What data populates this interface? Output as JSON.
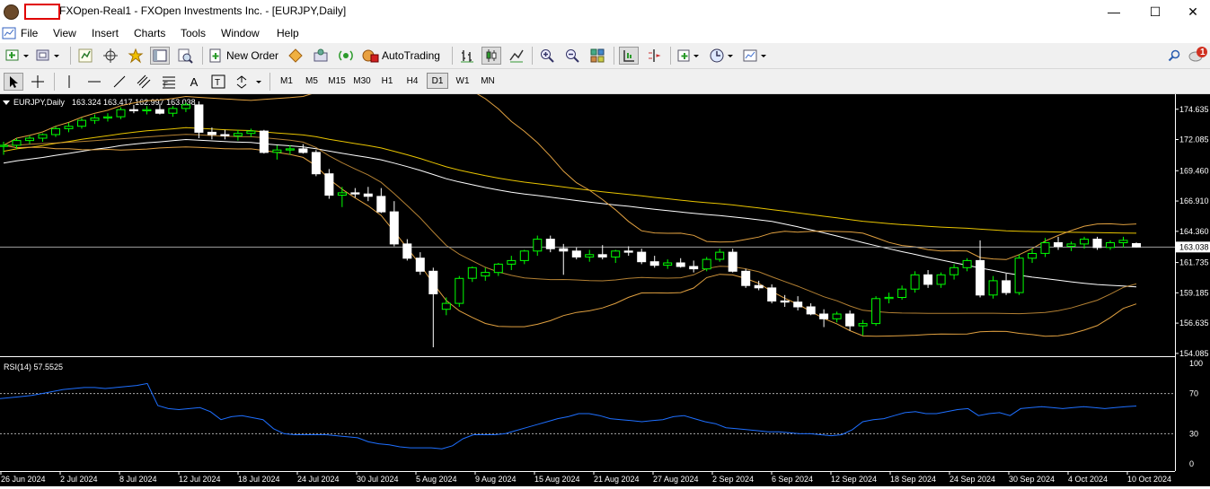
{
  "window": {
    "title": "FXOpen-Real1 - FXOpen Investments Inc. - [EURJPY,Daily]",
    "minimize": "—",
    "maximize": "☐",
    "close": "✕"
  },
  "menu": [
    "File",
    "View",
    "Insert",
    "Charts",
    "Tools",
    "Window",
    "Help"
  ],
  "mdi_controls": [
    "_",
    "🗗",
    "✕"
  ],
  "toolbar": {
    "new_order": "New Order",
    "auto_trading": "AutoTrading",
    "alert_count": "1"
  },
  "timeframes": [
    "M1",
    "M5",
    "M15",
    "M30",
    "H1",
    "H4",
    "D1",
    "W1",
    "MN"
  ],
  "active_timeframe": "D1",
  "colors": {
    "bg": "#000000",
    "bull_candle": "#00ff00",
    "bear_candle": "#ffffff",
    "ma_white": "#ffffff",
    "ma_yellow": "#e8c400",
    "band_orange": "#e0a040",
    "price_line": "#a0a0a0",
    "rsi_line": "#1e6fff",
    "axis_text": "#ffffff"
  },
  "chart_data": [
    {
      "type": "candlestick",
      "title": "EURJPY,Daily",
      "ohlc_label": "163.324 163.417 162.997 163.038",
      "current_price": 163.038,
      "ylim": [
        154.085,
        175.9
      ],
      "y_ticks": [
        "174.635",
        "172.085",
        "169.460",
        "166.910",
        "164.360",
        "163.038",
        "161.735",
        "159.185",
        "156.635",
        "154.085"
      ],
      "x_ticks": [
        "26 Jun 2024",
        "2 Jul 2024",
        "8 Jul 2024",
        "12 Jul 2024",
        "18 Jul 2024",
        "24 Jul 2024",
        "30 Jul 2024",
        "5 Aug 2024",
        "9 Aug 2024",
        "15 Aug 2024",
        "21 Aug 2024",
        "27 Aug 2024",
        "2 Sep 2024",
        "6 Sep 2024",
        "12 Sep 2024",
        "18 Sep 2024",
        "24 Sep 2024",
        "30 Sep 2024",
        "4 Oct 2024",
        "10 Oct 2024"
      ],
      "candles": [
        [
          171.5,
          171.9,
          170.8,
          171.6
        ],
        [
          171.6,
          172.2,
          171.3,
          172.0
        ],
        [
          172.0,
          172.4,
          171.7,
          172.2
        ],
        [
          172.2,
          172.6,
          171.9,
          172.5
        ],
        [
          172.5,
          173.2,
          172.3,
          173.0
        ],
        [
          173.0,
          173.5,
          172.7,
          173.2
        ],
        [
          173.2,
          173.9,
          173.0,
          173.7
        ],
        [
          173.7,
          174.2,
          173.4,
          173.9
        ],
        [
          173.9,
          174.3,
          173.6,
          174.0
        ],
        [
          174.0,
          174.8,
          173.8,
          174.6
        ],
        [
          174.6,
          175.0,
          174.3,
          174.5
        ],
        [
          174.5,
          174.9,
          174.2,
          174.6
        ],
        [
          174.6,
          175.1,
          174.2,
          174.3
        ],
        [
          174.3,
          174.9,
          174.0,
          174.7
        ],
        [
          174.7,
          175.2,
          174.4,
          175.0
        ],
        [
          175.0,
          175.3,
          172.2,
          172.7
        ],
        [
          172.7,
          173.1,
          172.1,
          172.5
        ],
        [
          172.5,
          172.9,
          172.1,
          172.4
        ],
        [
          172.4,
          172.9,
          172.0,
          172.6
        ],
        [
          172.6,
          173.0,
          172.3,
          172.8
        ],
        [
          172.8,
          172.9,
          170.9,
          171.0
        ],
        [
          171.0,
          171.6,
          170.4,
          171.2
        ],
        [
          171.2,
          171.6,
          170.8,
          171.3
        ],
        [
          171.3,
          171.7,
          170.9,
          171.0
        ],
        [
          171.0,
          171.2,
          169.0,
          169.2
        ],
        [
          169.2,
          169.6,
          167.1,
          167.4
        ],
        [
          167.4,
          168.1,
          166.4,
          167.6
        ],
        [
          167.6,
          168.0,
          167.2,
          167.5
        ],
        [
          167.5,
          168.1,
          166.9,
          167.3
        ],
        [
          167.3,
          168.0,
          165.9,
          166.0
        ],
        [
          166.0,
          166.9,
          163.1,
          163.3
        ],
        [
          163.3,
          163.7,
          161.9,
          162.1
        ],
        [
          162.1,
          162.6,
          160.7,
          161.0
        ],
        [
          161.0,
          161.3,
          154.6,
          159.1
        ],
        [
          157.8,
          158.8,
          157.3,
          158.3
        ],
        [
          158.3,
          160.6,
          158.0,
          160.4
        ],
        [
          160.4,
          161.4,
          160.1,
          161.3
        ],
        [
          160.6,
          161.3,
          160.2,
          160.9
        ],
        [
          160.9,
          161.7,
          160.6,
          161.6
        ],
        [
          161.6,
          162.3,
          161.1,
          161.9
        ],
        [
          161.9,
          162.8,
          161.6,
          162.7
        ],
        [
          162.7,
          164.0,
          162.3,
          163.7
        ],
        [
          163.7,
          164.0,
          162.6,
          162.9
        ],
        [
          162.9,
          163.3,
          160.7,
          162.7
        ],
        [
          162.7,
          163.0,
          162.0,
          162.2
        ],
        [
          162.2,
          162.8,
          161.8,
          162.4
        ],
        [
          162.4,
          163.2,
          162.0,
          162.2
        ],
        [
          162.2,
          162.8,
          161.7,
          162.7
        ],
        [
          162.7,
          163.1,
          162.3,
          162.6
        ],
        [
          162.6,
          162.9,
          161.6,
          161.8
        ],
        [
          161.8,
          162.3,
          161.3,
          161.5
        ],
        [
          161.5,
          162.0,
          161.2,
          161.7
        ],
        [
          161.7,
          162.1,
          161.3,
          161.4
        ],
        [
          161.4,
          161.9,
          160.9,
          161.2
        ],
        [
          161.2,
          162.2,
          161.0,
          162.0
        ],
        [
          162.0,
          162.9,
          161.8,
          162.6
        ],
        [
          162.6,
          162.9,
          160.9,
          161.0
        ],
        [
          161.0,
          161.2,
          159.6,
          159.8
        ],
        [
          159.8,
          160.2,
          159.4,
          159.6
        ],
        [
          159.6,
          159.9,
          158.3,
          158.5
        ],
        [
          158.5,
          159.0,
          158.0,
          158.4
        ],
        [
          158.4,
          158.9,
          157.7,
          158.0
        ],
        [
          158.0,
          158.3,
          157.3,
          157.4
        ],
        [
          157.4,
          157.8,
          156.3,
          157.0
        ],
        [
          157.0,
          157.6,
          156.7,
          157.4
        ],
        [
          157.4,
          157.7,
          156.0,
          156.4
        ],
        [
          156.4,
          156.9,
          155.6,
          156.6
        ],
        [
          156.6,
          158.9,
          156.4,
          158.7
        ],
        [
          158.7,
          159.2,
          158.3,
          158.8
        ],
        [
          158.8,
          159.8,
          158.6,
          159.5
        ],
        [
          159.5,
          161.0,
          159.2,
          160.7
        ],
        [
          160.7,
          161.1,
          159.6,
          159.9
        ],
        [
          159.9,
          160.9,
          159.6,
          160.7
        ],
        [
          160.7,
          161.6,
          160.3,
          161.3
        ],
        [
          161.3,
          162.1,
          161.0,
          161.9
        ],
        [
          161.9,
          163.6,
          158.8,
          159.0
        ],
        [
          159.0,
          160.6,
          158.7,
          160.2
        ],
        [
          160.2,
          160.8,
          159.0,
          159.2
        ],
        [
          159.2,
          162.4,
          159.0,
          162.1
        ],
        [
          162.1,
          162.9,
          161.7,
          162.5
        ],
        [
          162.5,
          163.8,
          162.2,
          163.4
        ],
        [
          163.4,
          163.9,
          162.8,
          163.1
        ],
        [
          163.1,
          163.5,
          162.7,
          163.3
        ],
        [
          163.3,
          163.9,
          162.9,
          163.7
        ],
        [
          163.7,
          163.9,
          162.8,
          163.0
        ],
        [
          163.0,
          163.6,
          162.8,
          163.4
        ],
        [
          163.4,
          163.9,
          163.0,
          163.6
        ],
        [
          163.324,
          163.417,
          162.997,
          163.038
        ]
      ]
    },
    {
      "type": "line",
      "title": "RSI(14) 57.5525",
      "ylim": [
        0,
        100
      ],
      "y_ticks": [
        "100",
        "70",
        "30",
        "0"
      ],
      "levels": [
        70,
        30
      ],
      "values": [
        65,
        66,
        67,
        68,
        70,
        72,
        74,
        75,
        76,
        76,
        75,
        76,
        77,
        78,
        80,
        58,
        55,
        54,
        55,
        56,
        52,
        44,
        47,
        48,
        46,
        44,
        35,
        30,
        29,
        29,
        29,
        29,
        28,
        27,
        26,
        22,
        20,
        19,
        17,
        16,
        16,
        16,
        15,
        18,
        25,
        29,
        29,
        29,
        30,
        33,
        36,
        39,
        42,
        45,
        47,
        50,
        50,
        48,
        45,
        44,
        43,
        42,
        43,
        44,
        47,
        48,
        45,
        42,
        40,
        36,
        35,
        34,
        33,
        32,
        32,
        31,
        30,
        30,
        29,
        28,
        29,
        34,
        42,
        44,
        45,
        48,
        51,
        52,
        50,
        50,
        52,
        54,
        55,
        48,
        50,
        51,
        48,
        55,
        56,
        57,
        56,
        55,
        56,
        57,
        56,
        55,
        56,
        57,
        57.55
      ]
    }
  ]
}
